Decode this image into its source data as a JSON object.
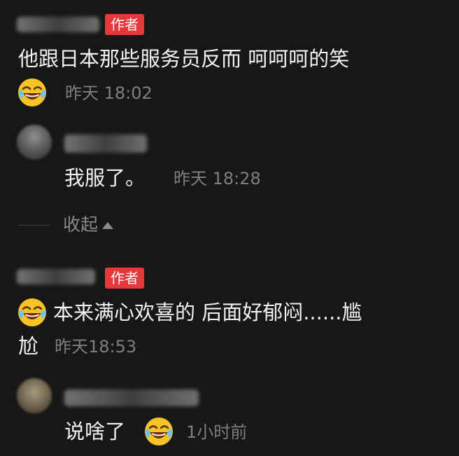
{
  "comments": [
    {
      "author_badge": "作者",
      "text": "他跟日本那些服务员反而 呵呵呵的笑",
      "time": "昨天 18:02",
      "emoji": "laughing-crying-emoji"
    },
    {
      "text": "我服了。",
      "time": "昨天 18:28"
    },
    {
      "author_badge": "作者",
      "text_line1": "本来满心欢喜的 后面好郁闷......尴",
      "text_line2": "尬",
      "time": "昨天18:53",
      "emoji": "laughing-crying-emoji"
    },
    {
      "text": "说啥了",
      "time": "1小时前",
      "emoji": "laughing-crying-emoji"
    }
  ],
  "collapse": {
    "label": "收起",
    "icon": "caret-up-icon"
  },
  "colors": {
    "background": "#171717",
    "badge": "#e5383b",
    "text": "#f2f2f2",
    "timestamp": "#7f7f7f"
  }
}
